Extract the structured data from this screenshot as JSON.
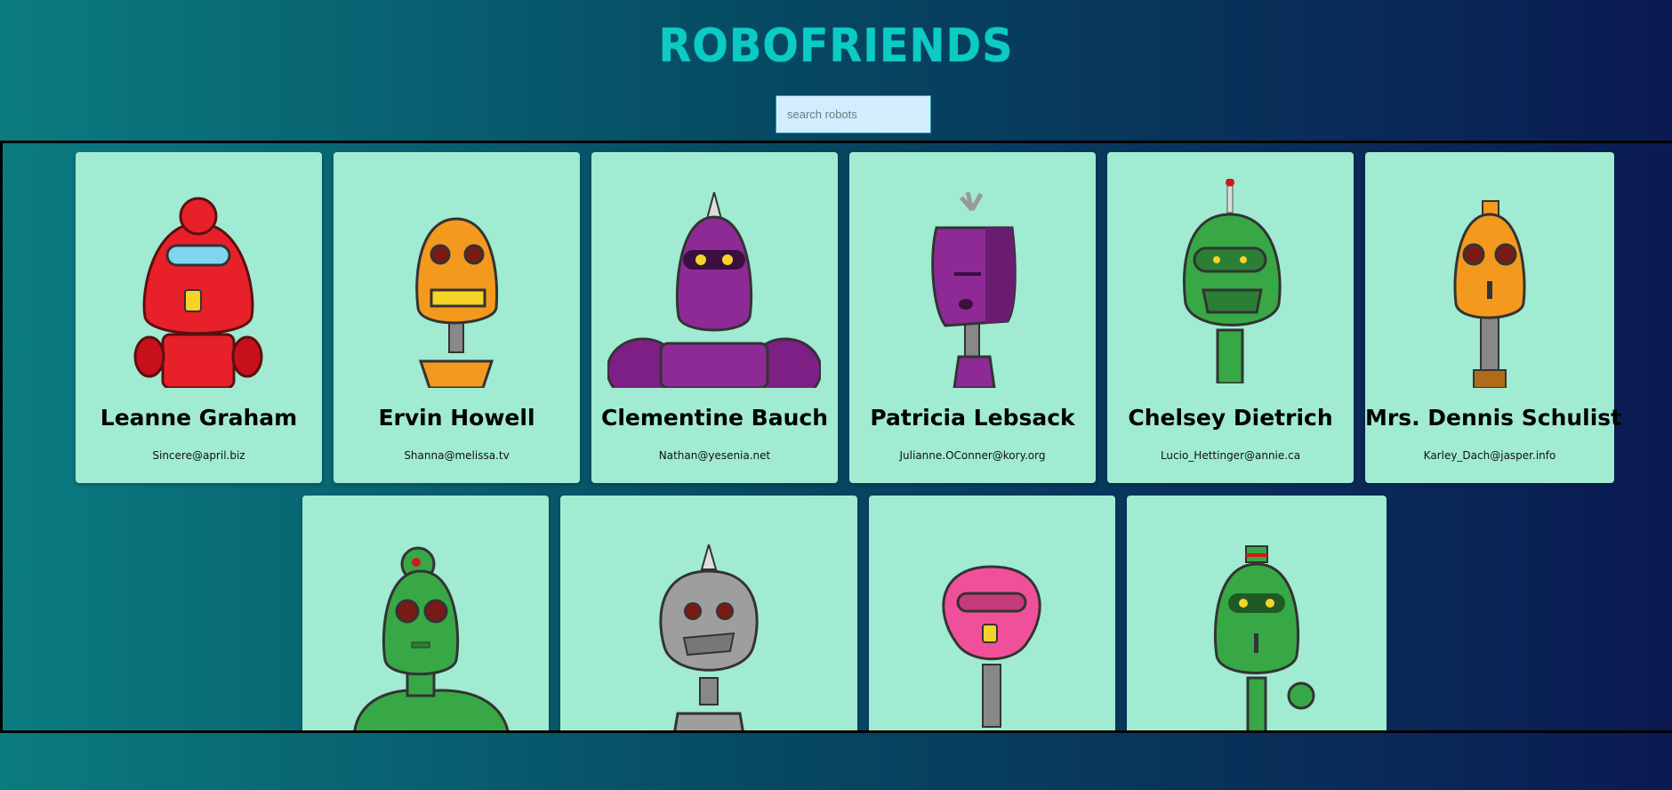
{
  "app": {
    "title": "ROBOFRIENDS"
  },
  "search": {
    "placeholder": "search robots",
    "value": ""
  },
  "robots": [
    {
      "name": "Leanne Graham",
      "email": "Sincere@april.biz",
      "color": "#e8202a"
    },
    {
      "name": "Ervin Howell",
      "email": "Shanna@melissa.tv",
      "color": "#f39a1e"
    },
    {
      "name": "Clementine Bauch",
      "email": "Nathan@yesenia.net",
      "color": "#8e2a96"
    },
    {
      "name": "Patricia Lebsack",
      "email": "Julianne.OConner@kory.org",
      "color": "#8e2a96"
    },
    {
      "name": "Chelsey Dietrich",
      "email": "Lucio_Hettinger@annie.ca",
      "color": "#37a845"
    },
    {
      "name": "Mrs. Dennis Schulist",
      "email": "Karley_Dach@jasper.info",
      "color": "#f39a1e"
    },
    {
      "name": "",
      "email": "",
      "color": "#37a845"
    },
    {
      "name": "",
      "email": "",
      "color": "#9e9e9e"
    },
    {
      "name": "",
      "email": "",
      "color": "#f0509a"
    },
    {
      "name": "",
      "email": "",
      "color": "#37a845"
    }
  ]
}
